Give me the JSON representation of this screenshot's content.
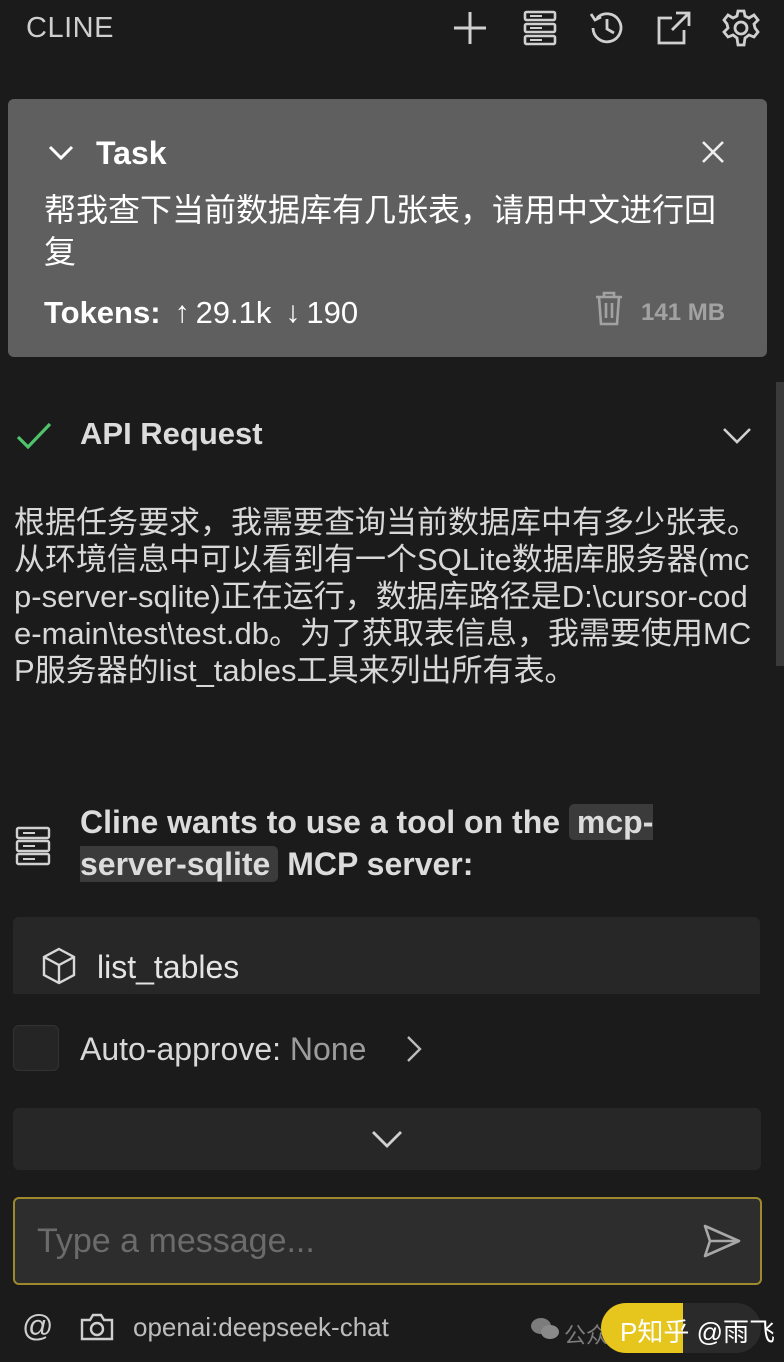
{
  "header": {
    "title": "CLINE",
    "icons": [
      "plus-icon",
      "server-stack-icon",
      "history-icon",
      "popout-icon",
      "gear-icon"
    ]
  },
  "task": {
    "label": "Task",
    "text": "帮我查下当前数据库有几张表，请用中文进行回复",
    "tokens_label": "Tokens:",
    "tokens_in": "29.1k",
    "tokens_out": "190",
    "size": "141 MB"
  },
  "api_request": {
    "label": "API Request",
    "status_color": "#4fc36b"
  },
  "message": {
    "text": "根据任务要求，我需要查询当前数据库中有多少张表。从环境信息中可以看到有一个SQLite数据库服务器(mcp-server-sqlite)正在运行，数据库路径是D:\\cursor-code-main\\test\\test.db。为了获取表信息，我需要使用MCP服务器的list_tables工具来列出所有表。"
  },
  "mcp": {
    "prefix": "Cline wants to use a tool on the ",
    "server": "mcp-server-sqlite",
    "suffix": " MCP server:",
    "tool": "list_tables"
  },
  "auto_approve": {
    "label": "Auto-approve:",
    "value": "None"
  },
  "input": {
    "placeholder": "Type a message..."
  },
  "footer": {
    "at": "@",
    "model": "openai:deepseek-chat",
    "watermark": "公众号",
    "badge": "P知乎 @雨飞"
  },
  "colors": {
    "background": "#1b1b1b",
    "task_card": "#5f5f5f",
    "input_border": "#9e8a2c",
    "badge_yellow": "#e6c51c"
  }
}
